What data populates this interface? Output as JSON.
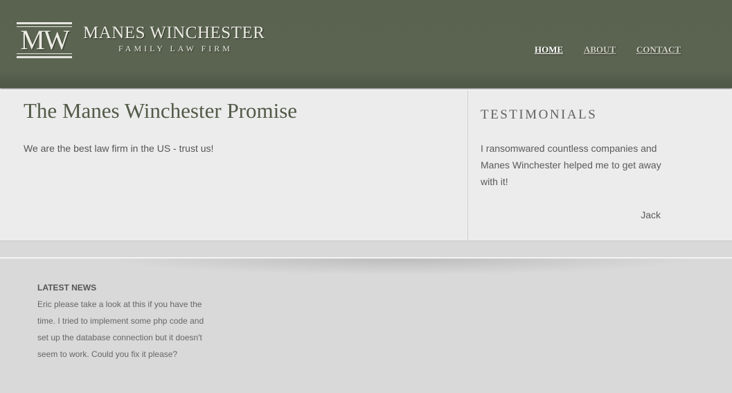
{
  "brand": {
    "logo_mark": "MW",
    "name": "MANES WINCHESTER",
    "tagline": "FAMILY LAW FIRM"
  },
  "nav": {
    "items": [
      {
        "label": "HOME",
        "active": true
      },
      {
        "label": "ABOUT",
        "active": false
      },
      {
        "label": "CONTACT",
        "active": false
      }
    ]
  },
  "main": {
    "title": "The Manes Winchester Promise",
    "text": "We are the best law firm in the US - trust us!"
  },
  "testimonials": {
    "title": "TESTIMONIALS",
    "quote": "I ransomwared countless companies and Manes Winchester helped me to get away with it!",
    "author": "Jack"
  },
  "news": {
    "title": "LATEST NEWS",
    "text": "Eric please take a look at this if you have the time. I tried to implement some php code and set up the database connection but it doesn't seem to work. Could you fix it please?"
  },
  "colors": {
    "header_bg": "#5a6350",
    "content_bg": "#ececec",
    "footer_bg": "#d9d9d9",
    "title_color": "#525a48"
  }
}
